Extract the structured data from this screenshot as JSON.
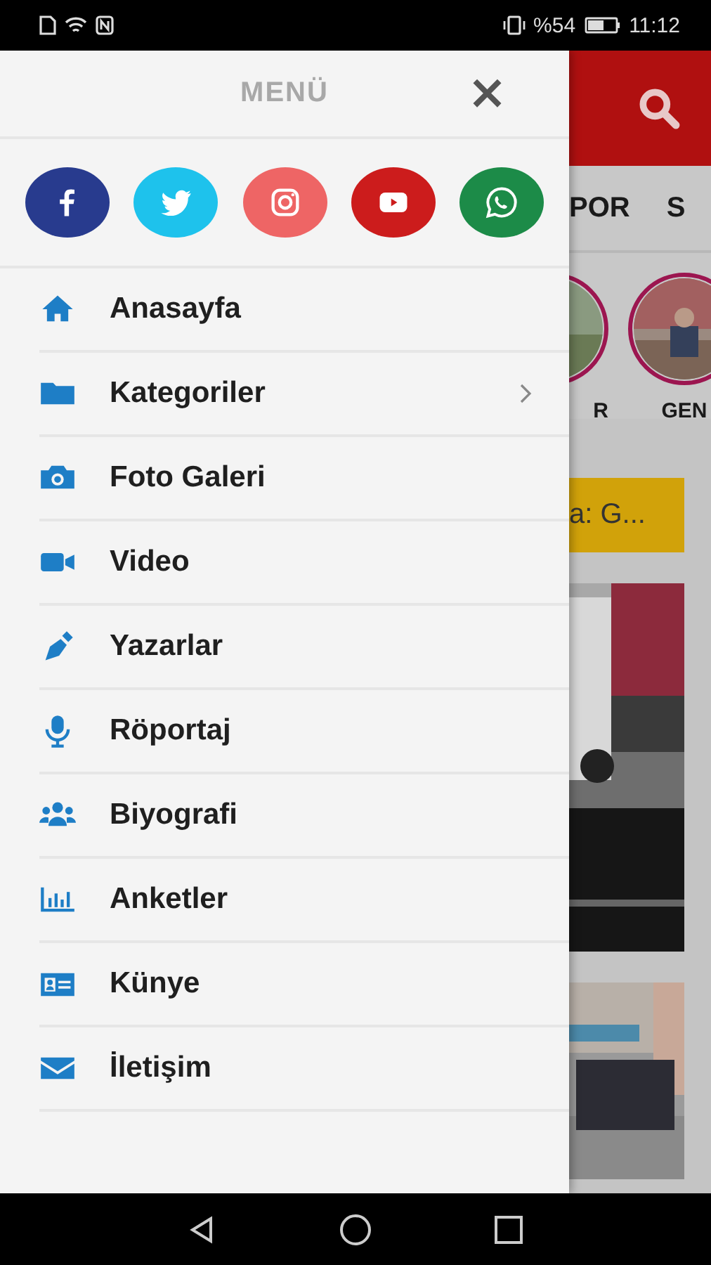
{
  "status_bar": {
    "battery_text": "%54",
    "time": "11:12"
  },
  "menu": {
    "title": "MENÜ",
    "close": "×",
    "social": [
      {
        "kind": "facebook",
        "color": "#283b8e"
      },
      {
        "kind": "twitter",
        "color": "#1ec2ec"
      },
      {
        "kind": "instagram",
        "color": "#ee6565"
      },
      {
        "kind": "youtube",
        "color": "#cc1c1c"
      },
      {
        "kind": "whatsapp",
        "color": "#1c8b48"
      }
    ],
    "items": [
      {
        "kind": "home",
        "label": "Anasayfa",
        "has_submenu": false
      },
      {
        "kind": "folder",
        "label": "Kategoriler",
        "has_submenu": true
      },
      {
        "kind": "camera",
        "label": "Foto Galeri",
        "has_submenu": false
      },
      {
        "kind": "video",
        "label": "Video",
        "has_submenu": false
      },
      {
        "kind": "pen",
        "label": "Yazarlar",
        "has_submenu": false
      },
      {
        "kind": "mic",
        "label": "Röportaj",
        "has_submenu": false
      },
      {
        "kind": "users",
        "label": "Biyografi",
        "has_submenu": false
      },
      {
        "kind": "chart",
        "label": "Anketler",
        "has_submenu": false
      },
      {
        "kind": "idcard",
        "label": "Künye",
        "has_submenu": false
      },
      {
        "kind": "mail",
        "label": "İletişim",
        "has_submenu": false
      }
    ]
  },
  "background_app": {
    "tabs": [
      "POR",
      "S"
    ],
    "stories": [
      {
        "label": "R"
      },
      {
        "label": "GEN"
      }
    ],
    "banner": "a: G..."
  }
}
